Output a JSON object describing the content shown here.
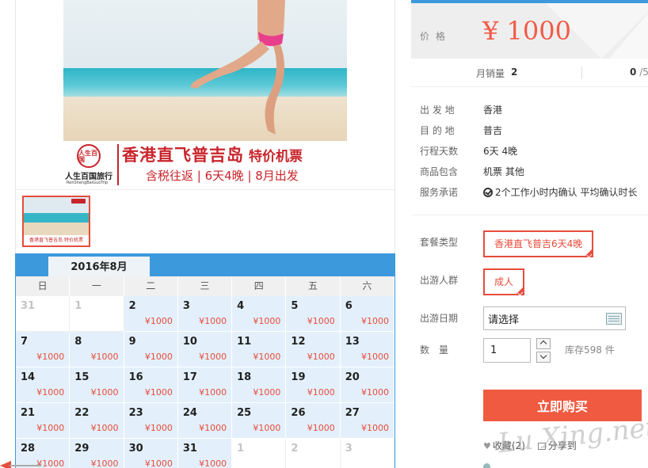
{
  "banner": {
    "logo_text": "人生百国",
    "agency_name": "人生百国旅行",
    "agency_sub": "RenShengBaiGuoTrip",
    "title": "香港直飞普吉岛",
    "tag": "特价机票",
    "subtitle": "含税往返 | 6天4晚 | 8月出发"
  },
  "thumbnail": {
    "caption": "香港直飞普吉岛 特价机票"
  },
  "calendar": {
    "month_label": "2016年8月",
    "weekdays": [
      "日",
      "一",
      "二",
      "三",
      "四",
      "五",
      "六"
    ],
    "days": [
      {
        "day": "31",
        "price": "",
        "available": false
      },
      {
        "day": "1",
        "price": "",
        "available": false
      },
      {
        "day": "2",
        "price": "¥1000",
        "available": true
      },
      {
        "day": "3",
        "price": "¥1000",
        "available": true
      },
      {
        "day": "4",
        "price": "¥1000",
        "available": true
      },
      {
        "day": "5",
        "price": "¥1000",
        "available": true
      },
      {
        "day": "6",
        "price": "¥1000",
        "available": true
      },
      {
        "day": "7",
        "price": "¥1000",
        "available": true
      },
      {
        "day": "8",
        "price": "¥1000",
        "available": true
      },
      {
        "day": "9",
        "price": "¥1000",
        "available": true
      },
      {
        "day": "10",
        "price": "¥1000",
        "available": true
      },
      {
        "day": "11",
        "price": "¥1000",
        "available": true
      },
      {
        "day": "12",
        "price": "¥1000",
        "available": true
      },
      {
        "day": "13",
        "price": "¥1000",
        "available": true
      },
      {
        "day": "14",
        "price": "¥1000",
        "available": true
      },
      {
        "day": "15",
        "price": "¥1000",
        "available": true
      },
      {
        "day": "16",
        "price": "¥1000",
        "available": true
      },
      {
        "day": "17",
        "price": "¥1000",
        "available": true
      },
      {
        "day": "18",
        "price": "¥1000",
        "available": true
      },
      {
        "day": "19",
        "price": "¥1000",
        "available": true
      },
      {
        "day": "20",
        "price": "¥1000",
        "available": true
      },
      {
        "day": "21",
        "price": "¥1000",
        "available": true
      },
      {
        "day": "22",
        "price": "¥1000",
        "available": true
      },
      {
        "day": "23",
        "price": "¥1000",
        "available": true
      },
      {
        "day": "24",
        "price": "¥1000",
        "available": true
      },
      {
        "day": "25",
        "price": "¥1000",
        "available": true
      },
      {
        "day": "26",
        "price": "¥1000",
        "available": true
      },
      {
        "day": "27",
        "price": "¥1000",
        "available": true
      },
      {
        "day": "28",
        "price": "¥1000",
        "available": true
      },
      {
        "day": "29",
        "price": "¥1000",
        "available": true
      },
      {
        "day": "30",
        "price": "¥1000",
        "available": true
      },
      {
        "day": "31",
        "price": "¥1000",
        "available": true
      },
      {
        "day": "1",
        "price": "",
        "available": false
      },
      {
        "day": "2",
        "price": "",
        "available": false
      },
      {
        "day": "3",
        "price": "",
        "available": false
      }
    ]
  },
  "price": {
    "label": "价格",
    "value": "¥ 1000"
  },
  "sales": {
    "label": "月销量",
    "value": "2",
    "rating_value": "0",
    "rating_total": "/5"
  },
  "info": [
    {
      "key": "出 发 地",
      "value": "香港"
    },
    {
      "key": "目 的 地",
      "value": "普吉"
    },
    {
      "key": "行程天数",
      "value": "6天 4晚"
    },
    {
      "key": "商品包含",
      "value": "机票  其他"
    },
    {
      "key": "服务承诺",
      "value": "2个工作小时内确认    平均确认时长"
    }
  ],
  "options": {
    "package_label": "套餐类型",
    "package_value": "香港直飞普吉6天4晚",
    "crowd_label": "出游人群",
    "crowd_value": "成人",
    "date_label": "出游日期",
    "date_value": "请选择",
    "qty_label": "数　量",
    "qty_value": "1",
    "stock": "库存598 件"
  },
  "buy_label": "立即购买",
  "fav": {
    "favorite": "收藏(2)",
    "share": "分享到"
  },
  "watermark": "Lu Xing.net",
  "colors": {
    "accent_blue": "#3c99dc",
    "price_red": "#f25c4a",
    "buy_orange": "#f05a40"
  }
}
